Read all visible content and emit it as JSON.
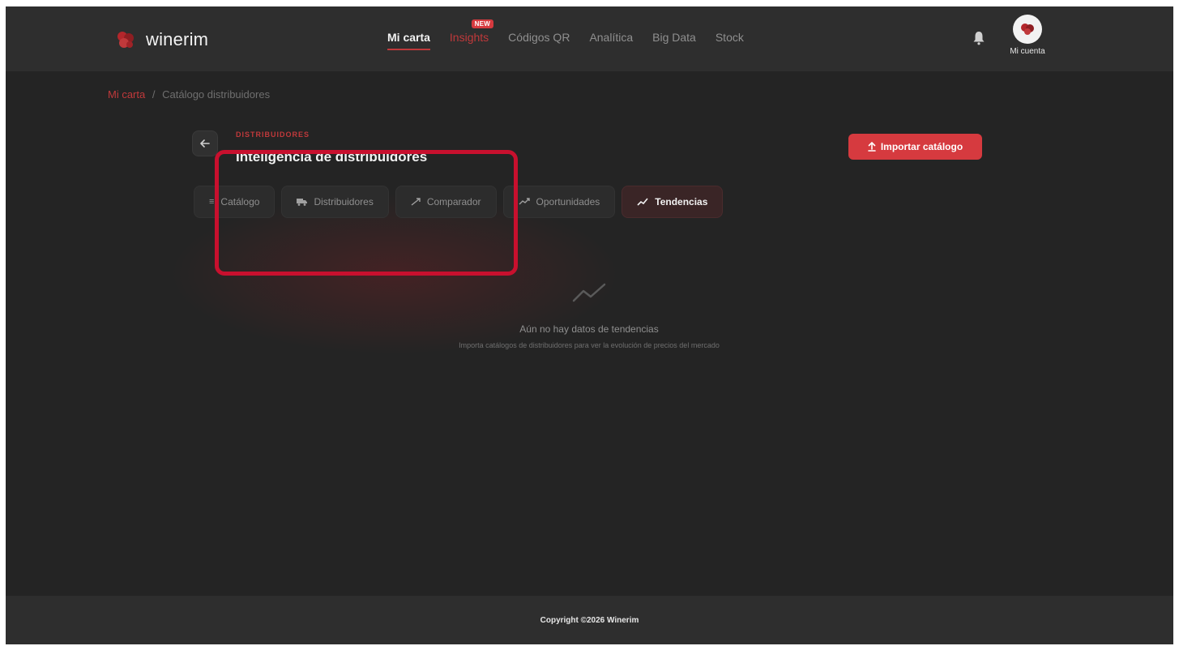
{
  "brand": {
    "name": "winerim"
  },
  "nav": {
    "items": [
      {
        "label": "Mi carta",
        "active": true
      },
      {
        "label": "Insights",
        "highlight": true,
        "badge": "NEW"
      },
      {
        "label": "Códigos QR"
      },
      {
        "label": "Analítica"
      },
      {
        "label": "Big Data"
      },
      {
        "label": "Stock"
      }
    ]
  },
  "account": {
    "label": "Mi cuenta"
  },
  "breadcrumb": {
    "home": "Mi carta",
    "separator": "/",
    "current": "Catálogo distribuidores"
  },
  "page": {
    "kicker": "DISTRIBUIDORES",
    "title": "Inteligencia de distribuidores",
    "import_label": "Importar catálogo"
  },
  "tabs": [
    {
      "label": "Catálogo",
      "icon": "list-icon"
    },
    {
      "label": "Distribuidores",
      "icon": "truck-icon"
    },
    {
      "label": "Comparador",
      "icon": "trend-icon"
    },
    {
      "label": "Oportunidades",
      "icon": "trend-up-icon"
    },
    {
      "label": "Tendencias",
      "icon": "trend-line-icon",
      "active": true
    }
  ],
  "empty_state": {
    "title": "Aún no hay datos de tendencias",
    "subtitle": "Importa catálogos de distribuidores para ver la evolución de precios del mercado"
  },
  "footer": {
    "copyright": "Copyright ©2026 Winerim"
  },
  "colors": {
    "accent": "#d63a3f",
    "background": "#242424",
    "header": "#2e2e2e",
    "annotation": "#c8102e"
  }
}
